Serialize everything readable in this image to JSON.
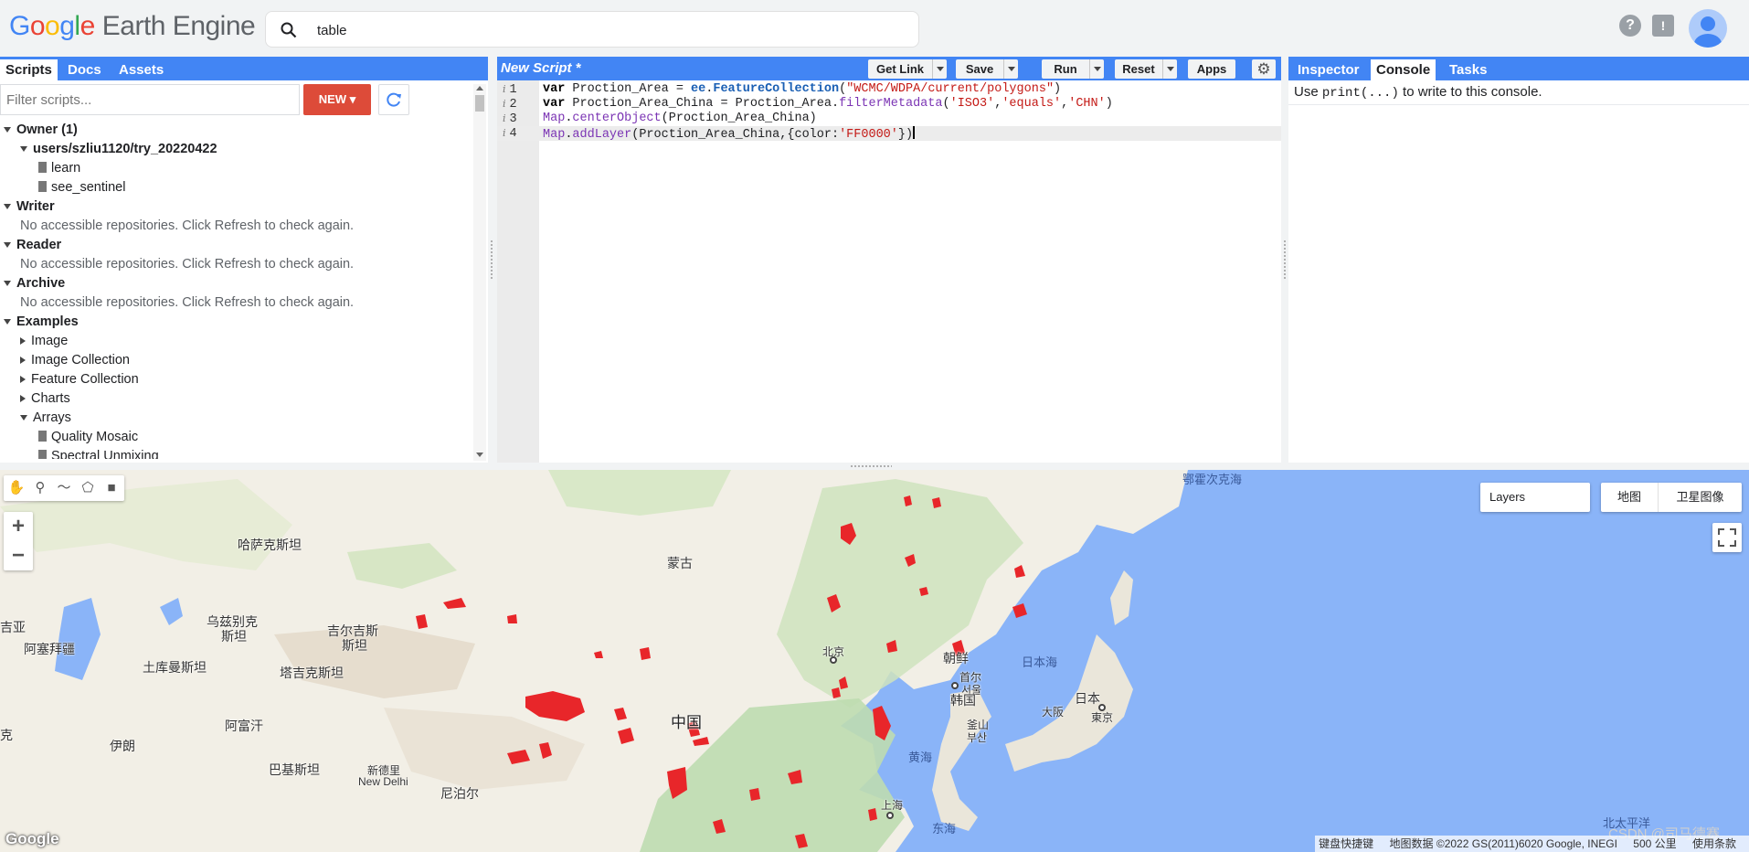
{
  "header": {
    "logo_google": [
      "G",
      "o",
      "o",
      "g",
      "l",
      "e"
    ],
    "logo_rest": "Earth Engine",
    "search_value": "table"
  },
  "left_panel": {
    "tabs": [
      "Scripts",
      "Docs",
      "Assets"
    ],
    "filter_placeholder": "Filter scripts...",
    "new_label": "NEW",
    "tree": [
      {
        "label": "Owner (1)",
        "kind": "group",
        "open": true,
        "indent": 0
      },
      {
        "label": "users/szliu1120/try_20220422",
        "kind": "repo",
        "open": true,
        "indent": 1
      },
      {
        "label": "learn",
        "kind": "file",
        "indent": 2
      },
      {
        "label": "see_sentinel",
        "kind": "file",
        "indent": 2
      },
      {
        "label": "Writer",
        "kind": "group",
        "open": true,
        "indent": 0
      },
      {
        "label": "No accessible repositories. Click Refresh to check again.",
        "kind": "note",
        "indent": 1
      },
      {
        "label": "Reader",
        "kind": "group",
        "open": true,
        "indent": 0
      },
      {
        "label": "No accessible repositories. Click Refresh to check again.",
        "kind": "note",
        "indent": 1
      },
      {
        "label": "Archive",
        "kind": "group",
        "open": true,
        "indent": 0
      },
      {
        "label": "No accessible repositories. Click Refresh to check again.",
        "kind": "note",
        "indent": 1
      },
      {
        "label": "Examples",
        "kind": "group",
        "open": true,
        "indent": 0
      },
      {
        "label": "Image",
        "kind": "folder",
        "open": false,
        "indent": 1
      },
      {
        "label": "Image Collection",
        "kind": "folder",
        "open": false,
        "indent": 1
      },
      {
        "label": "Feature Collection",
        "kind": "folder",
        "open": false,
        "indent": 1
      },
      {
        "label": "Charts",
        "kind": "folder",
        "open": false,
        "indent": 1
      },
      {
        "label": "Arrays",
        "kind": "folder",
        "open": true,
        "indent": 1
      },
      {
        "label": "Quality Mosaic",
        "kind": "file",
        "indent": 2
      },
      {
        "label": "Spectral Unmixing",
        "kind": "file",
        "indent": 2
      }
    ]
  },
  "editor": {
    "title": "New Script *",
    "buttons": {
      "get_link": "Get Link",
      "save": "Save",
      "run": "Run",
      "reset": "Reset",
      "apps": "Apps"
    },
    "lines": [
      {
        "n": "1",
        "tokens": [
          [
            "kw",
            "var"
          ],
          [
            "",
            " Proction_Area = "
          ],
          [
            "ee",
            "ee"
          ],
          [
            "",
            "."
          ],
          [
            "ee",
            "FeatureCollection"
          ],
          [
            "",
            "("
          ],
          [
            "str",
            "\"WCMC/WDPA/current/polygons\""
          ],
          [
            "",
            ")"
          ]
        ]
      },
      {
        "n": "2",
        "tokens": [
          [
            "kw",
            "var"
          ],
          [
            "",
            " Proction_Area_China = Proction_Area."
          ],
          [
            "fn",
            "filterMetadata"
          ],
          [
            "",
            "("
          ],
          [
            "str",
            "'ISO3'"
          ],
          [
            "",
            ","
          ],
          [
            "str",
            "'equals'"
          ],
          [
            "",
            ","
          ],
          [
            "str",
            "'CHN'"
          ],
          [
            "",
            ")"
          ]
        ]
      },
      {
        "n": "3",
        "tokens": [
          [
            "fn",
            "Map"
          ],
          [
            "",
            "."
          ],
          [
            "fn",
            "centerObject"
          ],
          [
            "",
            "(Proction_Area_China)"
          ]
        ]
      },
      {
        "n": "4",
        "tokens": [
          [
            "fn",
            "Map"
          ],
          [
            "",
            "."
          ],
          [
            "fn",
            "addLayer"
          ],
          [
            "",
            "(Proction_Area_China,{color:"
          ],
          [
            "str",
            "'FF0000'"
          ],
          [
            "",
            "})"
          ]
        ]
      }
    ]
  },
  "right_panel": {
    "tabs": [
      "Inspector",
      "Console",
      "Tasks"
    ],
    "console_pre": "Use ",
    "console_code": "print(...)",
    "console_post": " to write to this console."
  },
  "map": {
    "layers_label": "Layers",
    "maptype": [
      "地图",
      "卫星图像"
    ],
    "labels": [
      {
        "t": "哈萨克斯坦",
        "cls": ""
      },
      {
        "t": "蒙古",
        "cls": ""
      },
      {
        "t": "乌兹别克",
        "cls": ""
      },
      {
        "t": "斯坦",
        "cls": ""
      },
      {
        "t": "吉尔吉斯",
        "cls": ""
      },
      {
        "t": "斯坦",
        "cls": ""
      },
      {
        "t": "吉亚",
        "cls": ""
      },
      {
        "t": "阿塞拜疆",
        "cls": ""
      },
      {
        "t": "土库曼斯坦",
        "cls": ""
      },
      {
        "t": "塔吉克斯坦",
        "cls": ""
      },
      {
        "t": "阿富汗",
        "cls": ""
      },
      {
        "t": "伊朗",
        "cls": ""
      },
      {
        "t": "克",
        "cls": ""
      },
      {
        "t": "巴基斯坦",
        "cls": ""
      },
      {
        "t": "新德里",
        "cls": "small"
      },
      {
        "t": "New Delhi",
        "cls": "small"
      },
      {
        "t": "尼泊尔",
        "cls": ""
      },
      {
        "t": "中国",
        "cls": "big"
      },
      {
        "t": "北京",
        "cls": "small"
      },
      {
        "t": "朝鲜",
        "cls": ""
      },
      {
        "t": "首尔",
        "cls": "small"
      },
      {
        "t": "서울",
        "cls": "small"
      },
      {
        "t": "韩国",
        "cls": ""
      },
      {
        "t": "釜山",
        "cls": "small"
      },
      {
        "t": "부산",
        "cls": "small"
      },
      {
        "t": "日本",
        "cls": ""
      },
      {
        "t": "大阪",
        "cls": "small"
      },
      {
        "t": "東京",
        "cls": "small"
      },
      {
        "t": "上海",
        "cls": "small"
      },
      {
        "t": "黄海",
        "cls": "sea"
      },
      {
        "t": "东海",
        "cls": "sea"
      },
      {
        "t": "日本海",
        "cls": "sea"
      },
      {
        "t": "鄂霍次克海",
        "cls": "sea"
      },
      {
        "t": "北太平洋",
        "cls": "sea"
      }
    ],
    "attribution": [
      "键盘快捷键",
      "地图数据 ©2022 GS(2011)6020 Google, INEGI",
      "500 公里",
      "使用条款"
    ],
    "google_logo": "Google",
    "watermark": "CSDN @司马德赛"
  },
  "colors": {
    "accent": "#4285f4",
    "new_button": "#dd4b39",
    "protected_area": "#ff0000",
    "land": "#f2efe6",
    "water": "#8ab4f8"
  }
}
